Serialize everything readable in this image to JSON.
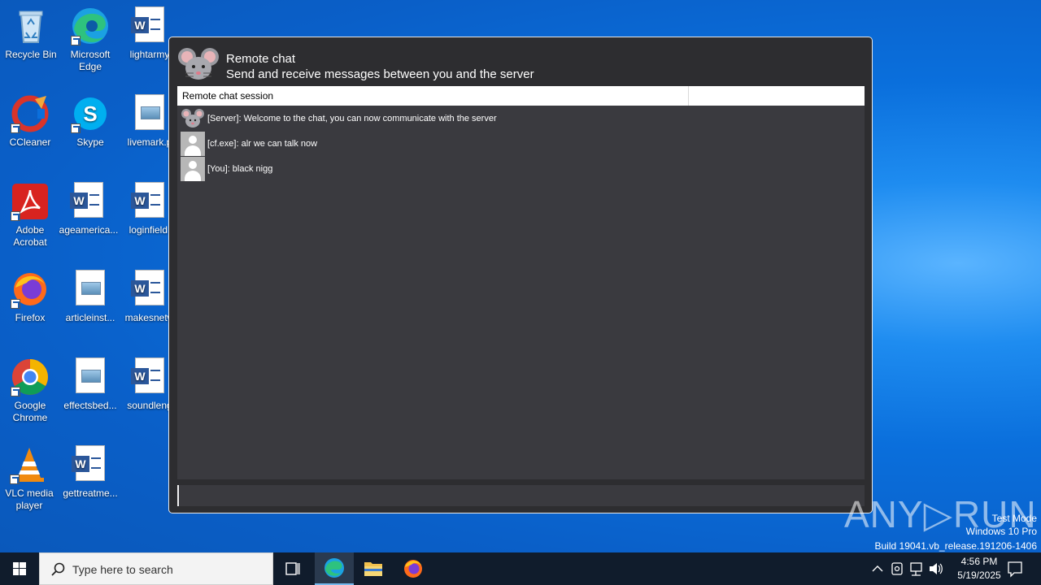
{
  "desktop": {
    "icons": [
      {
        "label": "Recycle Bin"
      },
      {
        "label": "Microsoft Edge"
      },
      {
        "label": "lightarmy"
      },
      {
        "label": "CCleaner"
      },
      {
        "label": "Skype"
      },
      {
        "label": "livemark.p"
      },
      {
        "label": "Adobe Acrobat"
      },
      {
        "label": "ageamerica..."
      },
      {
        "label": "loginfield."
      },
      {
        "label": "Firefox"
      },
      {
        "label": "articleinst..."
      },
      {
        "label": "makesnetw"
      },
      {
        "label": "Google Chrome"
      },
      {
        "label": "effectsbed..."
      },
      {
        "label": "soundleng"
      },
      {
        "label": "VLC media player"
      },
      {
        "label": "gettreatme..."
      }
    ]
  },
  "chat": {
    "title": "Remote chat",
    "subtitle": "Send and receive messages between you and the server",
    "session_header": "Remote chat session",
    "messages": [
      {
        "text": "[Server]: Welcome to the chat, you can now communicate with the server"
      },
      {
        "text": "[cf.exe]: alr we can talk now"
      },
      {
        "text": "[You]: black nigg"
      }
    ],
    "input_value": ""
  },
  "watermark": {
    "brand": "ANY▷RUN",
    "line1": "Test Mode",
    "line2": "Windows 10 Pro",
    "line3": "Build 19041.vb_release.191206-1406"
  },
  "taskbar": {
    "search_placeholder": "Type here to search",
    "time": "4:56 PM",
    "date": "5/19/2025"
  },
  "colors": {
    "accent": "#0a6fdc",
    "chat_bg": "#2d2d30",
    "taskbar_bg": "#101c2c"
  }
}
